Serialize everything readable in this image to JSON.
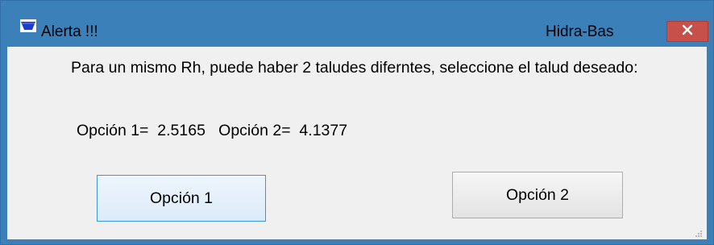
{
  "window": {
    "title": "Alerta !!!",
    "app_name": "Hidra-Bas",
    "close_glyph": "✕"
  },
  "dialog": {
    "message": "Para un mismo Rh, puede haber 2 taludes diferntes, seleccione el talud deseado:",
    "options_text": "Opción 1=  2.5165   Opción 2=  4.1377"
  },
  "buttons": {
    "option1_label": "Opción 1",
    "option2_label": "Opción 2"
  },
  "colors": {
    "titlebar": "#3c80ba",
    "close_button": "#c7504b",
    "client_background": "#f0f0f0",
    "focused_button_border": "#3c93e0"
  },
  "icons": {
    "app": "water-channel-icon",
    "close": "close-icon",
    "grip": "resize-grip-icon"
  }
}
